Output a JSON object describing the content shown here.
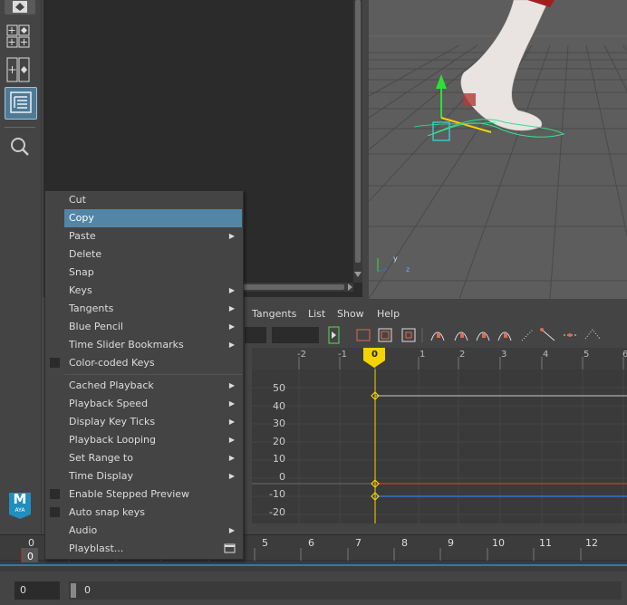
{
  "context_menu": {
    "items": [
      {
        "label": "Cut",
        "submenu": false,
        "checkbox": false,
        "highlighted": false
      },
      {
        "label": "Copy",
        "submenu": false,
        "checkbox": false,
        "highlighted": true
      },
      {
        "label": "Paste",
        "submenu": true,
        "checkbox": false,
        "highlighted": false
      },
      {
        "label": "Delete",
        "submenu": false,
        "checkbox": false,
        "highlighted": false
      },
      {
        "label": "Snap",
        "submenu": false,
        "checkbox": false,
        "highlighted": false
      },
      {
        "label": "Keys",
        "submenu": true,
        "checkbox": false,
        "highlighted": false
      },
      {
        "label": "Tangents",
        "submenu": true,
        "checkbox": false,
        "highlighted": false
      },
      {
        "label": "Blue Pencil",
        "submenu": true,
        "checkbox": false,
        "highlighted": false
      },
      {
        "label": "Time Slider Bookmarks",
        "submenu": true,
        "checkbox": false,
        "highlighted": false
      },
      {
        "label": "Color-coded Keys",
        "submenu": false,
        "checkbox": true,
        "highlighted": false
      },
      {
        "label": "Cached Playback",
        "submenu": true,
        "checkbox": false,
        "highlighted": false
      },
      {
        "label": "Playback Speed",
        "submenu": true,
        "checkbox": false,
        "highlighted": false
      },
      {
        "label": "Display Key Ticks",
        "submenu": true,
        "checkbox": false,
        "highlighted": false
      },
      {
        "label": "Playback Looping",
        "submenu": true,
        "checkbox": false,
        "highlighted": false
      },
      {
        "label": "Set Range to",
        "submenu": true,
        "checkbox": false,
        "highlighted": false
      },
      {
        "label": "Time Display",
        "submenu": true,
        "checkbox": false,
        "highlighted": false
      },
      {
        "label": "Enable Stepped Preview",
        "submenu": false,
        "checkbox": true,
        "highlighted": false
      },
      {
        "label": "Auto snap keys",
        "submenu": false,
        "checkbox": true,
        "highlighted": false
      },
      {
        "label": "Audio",
        "submenu": true,
        "checkbox": false,
        "highlighted": false
      },
      {
        "label": "Playblast...",
        "submenu": false,
        "checkbox": false,
        "highlighted": false,
        "option_box": true
      }
    ]
  },
  "graph_editor": {
    "menus": [
      "Tangents",
      "List",
      "Show",
      "Help"
    ],
    "ruler_ticks": [
      "-2",
      "-1",
      "0",
      "1",
      "2",
      "3",
      "4",
      "5",
      "6"
    ],
    "current_frame": "0",
    "y_labels": [
      "50",
      "40",
      "30",
      "20",
      "10",
      "0",
      "-10",
      "-20"
    ]
  },
  "time_slider": {
    "ticks": [
      "0",
      "5",
      "6",
      "7",
      "8",
      "9",
      "10",
      "11",
      "12"
    ],
    "current_frame": "0"
  },
  "range": {
    "start_field": "0",
    "range_start": "0"
  },
  "app_badge": {
    "letter": "M",
    "sub": "AYA"
  },
  "colors": {
    "highlight": "#5285a6",
    "curve_red": "#c0392b",
    "curve_blue": "#3a6fc9",
    "playhead": "#f5d300"
  }
}
